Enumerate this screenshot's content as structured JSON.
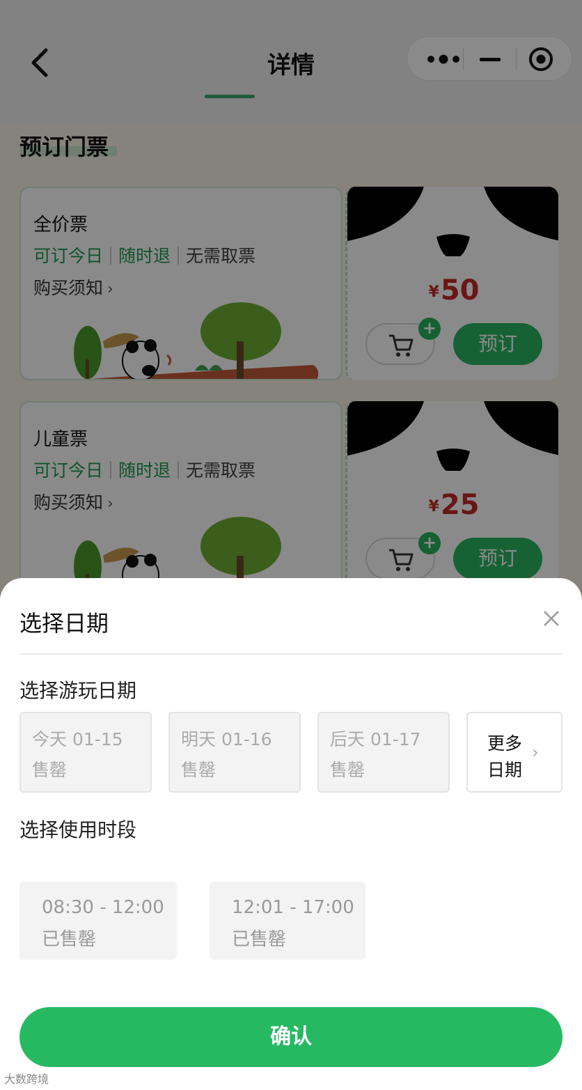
{
  "nav": {
    "title": "详情"
  },
  "section": {
    "title": "预订门票"
  },
  "tickets": [
    {
      "name": "全价票",
      "tags": [
        "可订今日",
        "随时退",
        "无需取票"
      ],
      "notice": "购买须知",
      "currency": "¥",
      "price": "50",
      "plus": "+",
      "book_label": "预订"
    },
    {
      "name": "儿童票",
      "tags": [
        "可订今日",
        "随时退",
        "无需取票"
      ],
      "notice": "购买须知",
      "currency": "¥",
      "price": "25",
      "plus": "+",
      "book_label": "预订"
    }
  ],
  "sheet": {
    "title": "选择日期",
    "play_date_label": "选择游玩日期",
    "dates": [
      {
        "top": "今天  01-15",
        "status": "售罄"
      },
      {
        "top": "明天  01-16",
        "status": "售罄"
      },
      {
        "top": "后天  01-17",
        "status": "售罄"
      }
    ],
    "more_dates": {
      "line1": "更多",
      "line2": "日期"
    },
    "time_label": "选择使用时段",
    "slots": [
      {
        "time": "08:30 - 12:00",
        "status": "已售罄"
      },
      {
        "time": "12:01 - 17:00",
        "status": "已售罄"
      }
    ],
    "confirm_label": "确认"
  },
  "watermark": "大数跨境",
  "colors": {
    "accent_green": "#27b962",
    "tag_green": "#1f9a4e",
    "price_red": "#c42a2a"
  }
}
